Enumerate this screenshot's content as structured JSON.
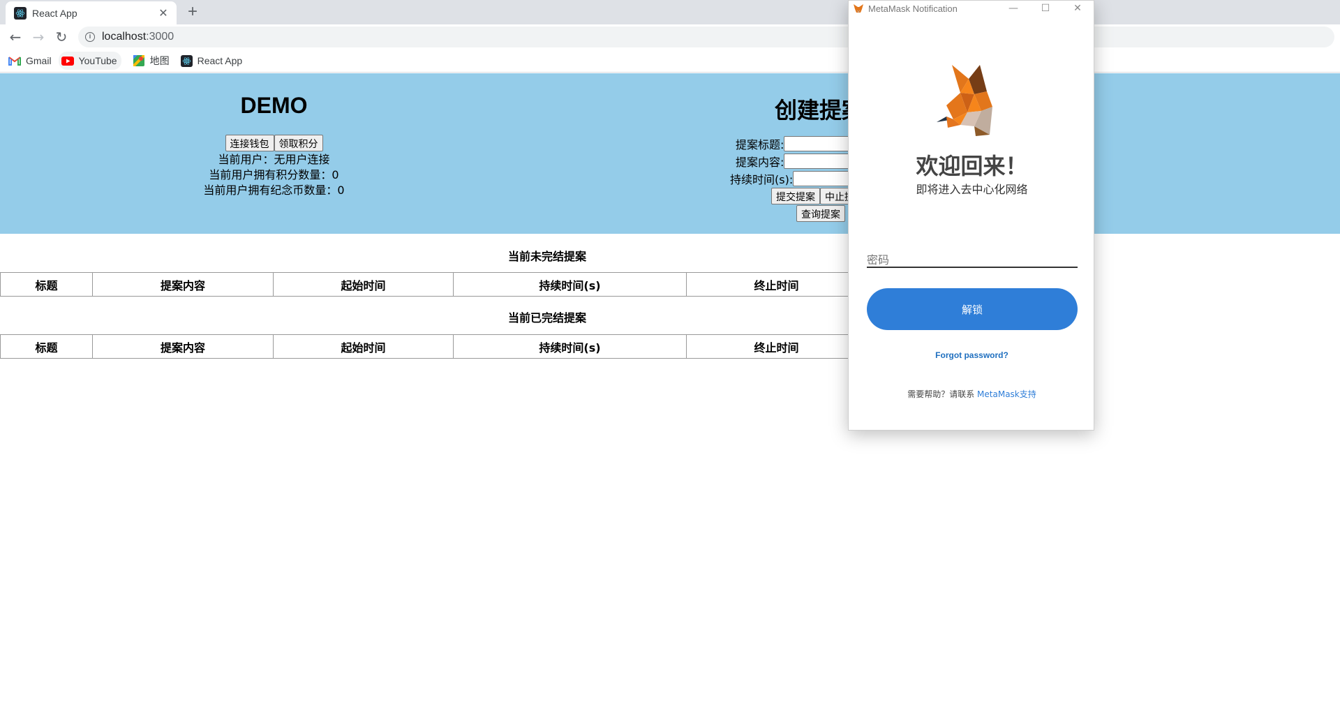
{
  "browser": {
    "tab_title": "React App",
    "url_host": "localhost",
    "url_port": ":3000",
    "bookmarks": [
      "Gmail",
      "YouTube",
      "地图",
      "React App"
    ]
  },
  "demo": {
    "title": "DEMO",
    "connect_wallet": "连接钱包",
    "claim_points": "领取积分",
    "current_user": "当前用户：无用户连接",
    "points_count": "当前用户拥有积分数量：0",
    "coins_count": "当前用户拥有纪念币数量：0"
  },
  "create": {
    "title": "创建提案",
    "title_label": "提案标题:",
    "content_label": "提案内容:",
    "duration_label": "持续时间(s):",
    "submit": "提交提案",
    "stop": "中止提案",
    "query": "查询提案"
  },
  "tables": {
    "open_title": "当前未完结提案",
    "closed_title": "当前已完结提案",
    "headers": [
      "标题",
      "提案内容",
      "起始时间",
      "持续时间(s)",
      "终止时间"
    ]
  },
  "metamask": {
    "window_title": "MetaMask Notification",
    "welcome": "欢迎回来！",
    "subtitle": "即将进入去中心化网络",
    "password_placeholder": "密码",
    "unlock": "解锁",
    "forgot": "Forgot password?",
    "help_prefix": "需要帮助？请联系 ",
    "help_link": "MetaMask支持"
  },
  "colors": {
    "hero_bg": "#94cce9",
    "unlock_bg": "#2f7ed8"
  }
}
